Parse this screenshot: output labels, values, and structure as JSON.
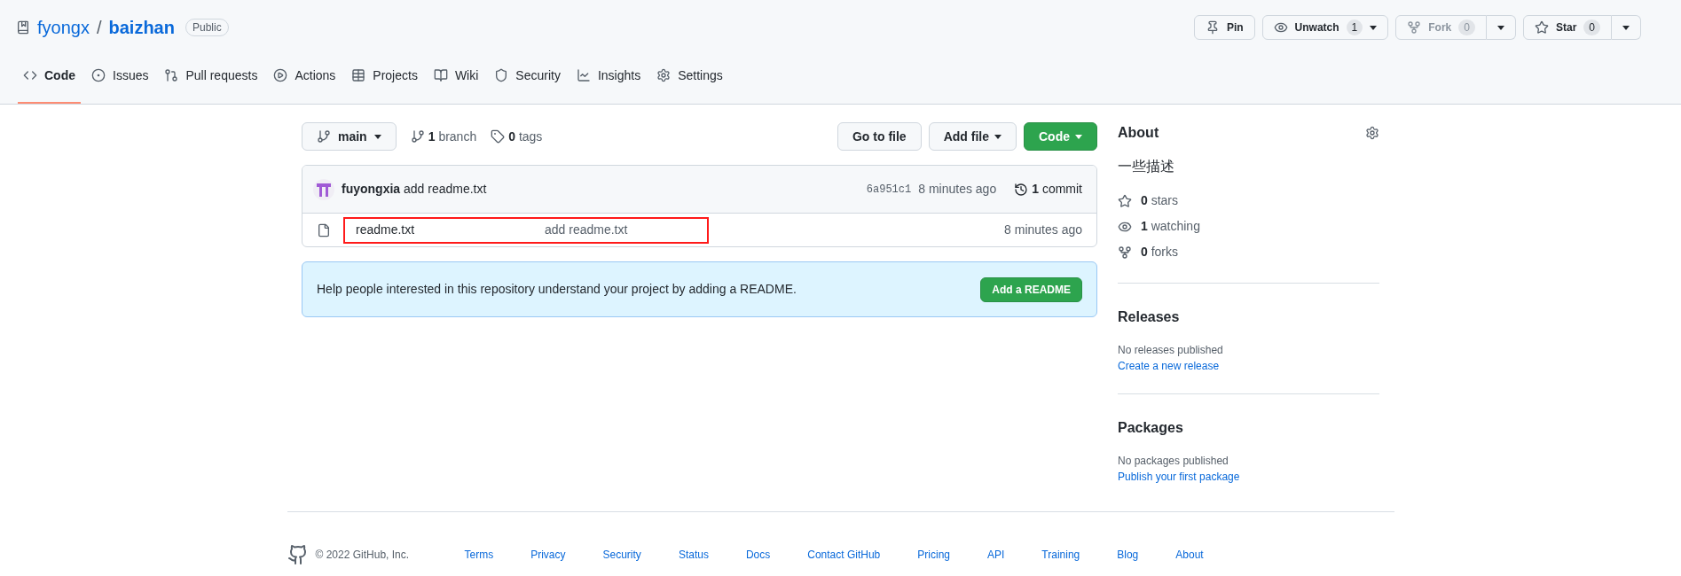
{
  "repo": {
    "owner": "fyongx",
    "separator": "/",
    "name": "baizhan",
    "visibility": "Public"
  },
  "header_actions": [
    {
      "kind": "pin",
      "label": "Pin",
      "disabled": false,
      "has_menu": false
    },
    {
      "kind": "eye",
      "label": "Unwatch",
      "count": "1",
      "disabled": false,
      "has_menu": true
    },
    {
      "kind": "fork",
      "label": "Fork",
      "count": "0",
      "disabled": true,
      "has_menu": true
    },
    {
      "kind": "star",
      "label": "Star",
      "count": "0",
      "disabled": false,
      "has_menu": true
    }
  ],
  "tabs": [
    {
      "kind": "code",
      "label": "Code",
      "selected": true
    },
    {
      "kind": "issues",
      "label": "Issues",
      "selected": false
    },
    {
      "kind": "pull",
      "label": "Pull requests",
      "selected": false
    },
    {
      "kind": "actions",
      "label": "Actions",
      "selected": false
    },
    {
      "kind": "projects",
      "label": "Projects",
      "selected": false
    },
    {
      "kind": "wiki",
      "label": "Wiki",
      "selected": false
    },
    {
      "kind": "security",
      "label": "Security",
      "selected": false
    },
    {
      "kind": "insights",
      "label": "Insights",
      "selected": false
    },
    {
      "kind": "settings",
      "label": "Settings",
      "selected": false
    }
  ],
  "branch_select": {
    "label": "main"
  },
  "branch_count": {
    "count": "1",
    "label": "branch"
  },
  "tag_count": {
    "count": "0",
    "label": "tags"
  },
  "toolbar_buttons": [
    {
      "kind": "plain",
      "label": "Go to file",
      "has_menu": false
    },
    {
      "kind": "plain",
      "label": "Add file",
      "has_menu": true
    },
    {
      "kind": "primary",
      "label": "Code",
      "has_menu": true
    }
  ],
  "latest_commit": {
    "author": "fuyongxia",
    "message": "add readme.txt",
    "sha": "6a951c1",
    "time": "8 minutes ago",
    "commits_count": "1",
    "commits_label": "commit"
  },
  "files": [
    {
      "name": "readme.txt",
      "message": "add readme.txt",
      "time": "8 minutes ago",
      "highlighted": true
    }
  ],
  "readme_prompt": {
    "text": "Help people interested in this repository understand your project by adding a README.",
    "button": "Add a README"
  },
  "about": {
    "heading": "About",
    "description": "一些描述",
    "stats": [
      {
        "kind": "star",
        "count": "0",
        "label": "stars"
      },
      {
        "kind": "eye",
        "count": "1",
        "label": "watching"
      },
      {
        "kind": "fork",
        "count": "0",
        "label": "forks"
      }
    ]
  },
  "sections": [
    {
      "heading": "Releases",
      "text": "No releases published",
      "link": "Create a new release"
    },
    {
      "heading": "Packages",
      "text": "No packages published",
      "link": "Publish your first package"
    }
  ],
  "footer": {
    "copyright": "© 2022 GitHub, Inc.",
    "links": [
      "Terms",
      "Privacy",
      "Security",
      "Status",
      "Docs",
      "Contact GitHub",
      "Pricing",
      "API",
      "Training",
      "Blog",
      "About"
    ]
  }
}
